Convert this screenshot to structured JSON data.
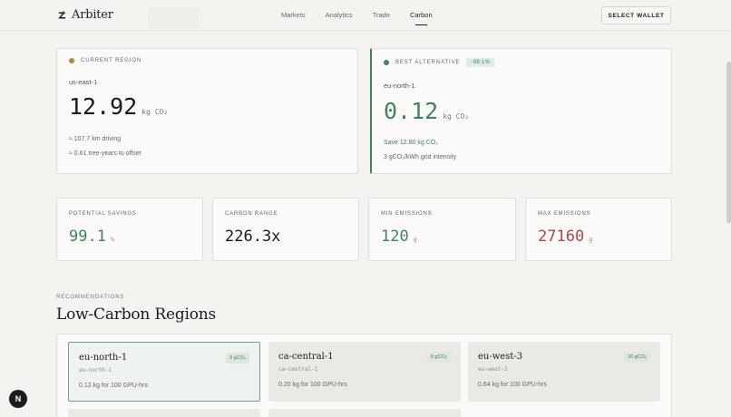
{
  "nav": {
    "brand": "Arbiter",
    "links": [
      "Markets",
      "Analytics",
      "Trade",
      "Carbon"
    ],
    "active": "Carbon",
    "wallet_button": "SELECT WALLET"
  },
  "current": {
    "label": "CURRENT REGION",
    "region": "us-east-1",
    "value": "12.92",
    "unit": "kg CO₂",
    "detail1": "≈ 107.7 km driving",
    "detail2": "≈ 0.61 tree-years to offset",
    "dot_color": "#b08a3e"
  },
  "best": {
    "label": "BEST ALTERNATIVE",
    "badge": "-99.1%",
    "region": "eu-north-1",
    "value": "0.12",
    "unit": "kg CO₂",
    "save": "Save 12.80 kg CO₂",
    "intensity": "3 gCO₂/kWh grid intensity",
    "dot_color": "#3e8460"
  },
  "stats": [
    {
      "label": "POTENTIAL SAVINGS",
      "value": "99.1",
      "unit": "%"
    },
    {
      "label": "CARBON RANGE",
      "value": "226.3x",
      "unit": ""
    },
    {
      "label": "MIN EMISSIONS",
      "value": "120",
      "unit": "g"
    },
    {
      "label": "MAX EMISSIONS",
      "value": "27160",
      "unit": "g"
    }
  ],
  "recommendations": {
    "caption": "RECOMMENDATIONS",
    "title": "Low-Carbon Regions",
    "items": [
      {
        "name": "eu-north-1",
        "code": "eu-north-1",
        "badge": "3 gCO₂",
        "desc": "0.12 kg for 100 GPU-hrs"
      },
      {
        "name": "ca-central-1",
        "code": "ca-central-1",
        "badge": "5 gCO₂",
        "desc": "0.20 kg for 100 GPU-hrs"
      },
      {
        "name": "eu-west-3",
        "code": "eu-west-3",
        "badge": "16 gCO₂",
        "desc": "0.64 kg for 100 GPU-hrs"
      }
    ]
  },
  "fab": "N",
  "colors": {
    "accent_green": "#3e8460",
    "accent_red": "#b04646",
    "background": "#f4f3ef"
  }
}
